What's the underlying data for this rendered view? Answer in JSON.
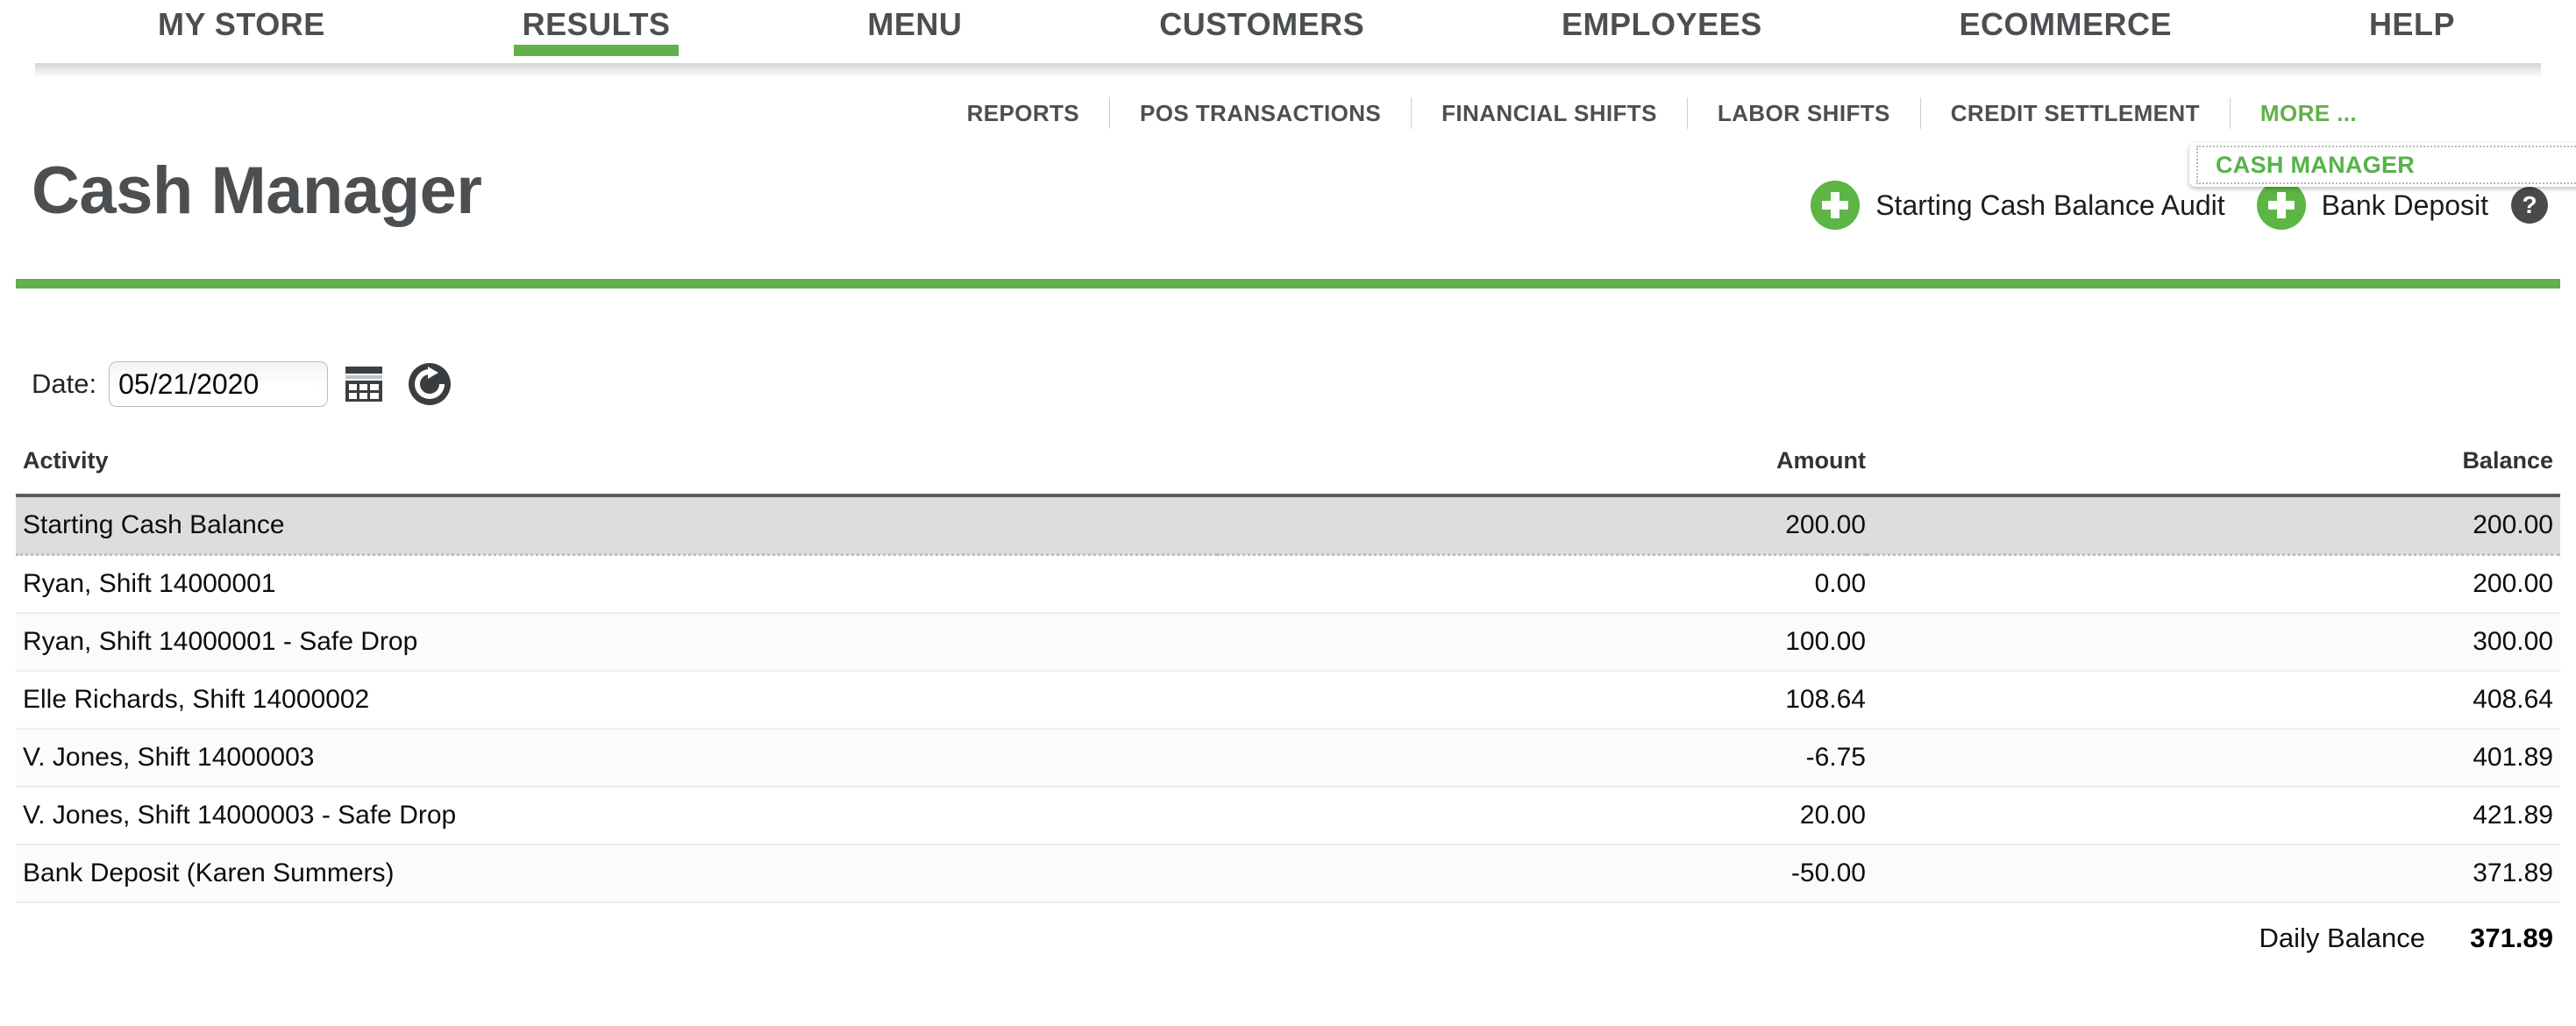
{
  "primary_nav": {
    "items": [
      {
        "label": "MY STORE",
        "active": false
      },
      {
        "label": "RESULTS",
        "active": true
      },
      {
        "label": "MENU",
        "active": false
      },
      {
        "label": "CUSTOMERS",
        "active": false
      },
      {
        "label": "EMPLOYEES",
        "active": false
      },
      {
        "label": "ECOMMERCE",
        "active": false
      },
      {
        "label": "HELP",
        "active": false
      }
    ]
  },
  "secondary_nav": {
    "items": [
      {
        "label": "REPORTS"
      },
      {
        "label": "POS TRANSACTIONS"
      },
      {
        "label": "FINANCIAL SHIFTS"
      },
      {
        "label": "LABOR SHIFTS"
      },
      {
        "label": "CREDIT SETTLEMENT"
      }
    ],
    "more_label": "MORE ..."
  },
  "dropdown": {
    "open": true,
    "items": [
      {
        "label": "CASH MANAGER"
      }
    ]
  },
  "header": {
    "title": "Cash Manager",
    "actions": [
      {
        "label": "Starting Cash Balance Audit",
        "icon": "plus-circle-icon"
      },
      {
        "label": "Bank Deposit",
        "icon": "plus-circle-icon"
      }
    ],
    "help_glyph": "?"
  },
  "filters": {
    "date_label": "Date:",
    "date_value": "05/21/2020",
    "date_placeholder": "mm/dd/yyyy",
    "calendar_icon": "calendar-icon",
    "refresh_icon": "refresh-icon"
  },
  "table": {
    "columns": [
      {
        "key": "activity",
        "label": "Activity",
        "align": "left"
      },
      {
        "key": "amount",
        "label": "Amount",
        "align": "right"
      },
      {
        "key": "balance",
        "label": "Balance",
        "align": "right"
      }
    ],
    "rows": [
      {
        "activity": "Starting Cash Balance",
        "amount": "200.00",
        "balance": "200.00",
        "highlight": true
      },
      {
        "activity": "Ryan, Shift 14000001",
        "amount": "0.00",
        "balance": "200.00",
        "highlight": false
      },
      {
        "activity": "Ryan, Shift 14000001 - Safe Drop",
        "amount": "100.00",
        "balance": "300.00",
        "highlight": false
      },
      {
        "activity": "Elle Richards, Shift 14000002",
        "amount": "108.64",
        "balance": "408.64",
        "highlight": false
      },
      {
        "activity": "V. Jones, Shift 14000003",
        "amount": "-6.75",
        "balance": "401.89",
        "highlight": false
      },
      {
        "activity": "V. Jones, Shift 14000003 - Safe Drop",
        "amount": "20.00",
        "balance": "421.89",
        "highlight": false
      },
      {
        "activity": "Bank Deposit (Karen Summers)",
        "amount": "-50.00",
        "balance": "371.89",
        "highlight": false
      }
    ]
  },
  "footer": {
    "total_label": "Daily Balance",
    "total_value": "371.89"
  },
  "colors": {
    "brand_green": "#62b04a",
    "accent_green": "#5cb544",
    "nav_text": "#4c4f52",
    "row_highlight": "#dddddd",
    "header_rule": "#575d61"
  }
}
